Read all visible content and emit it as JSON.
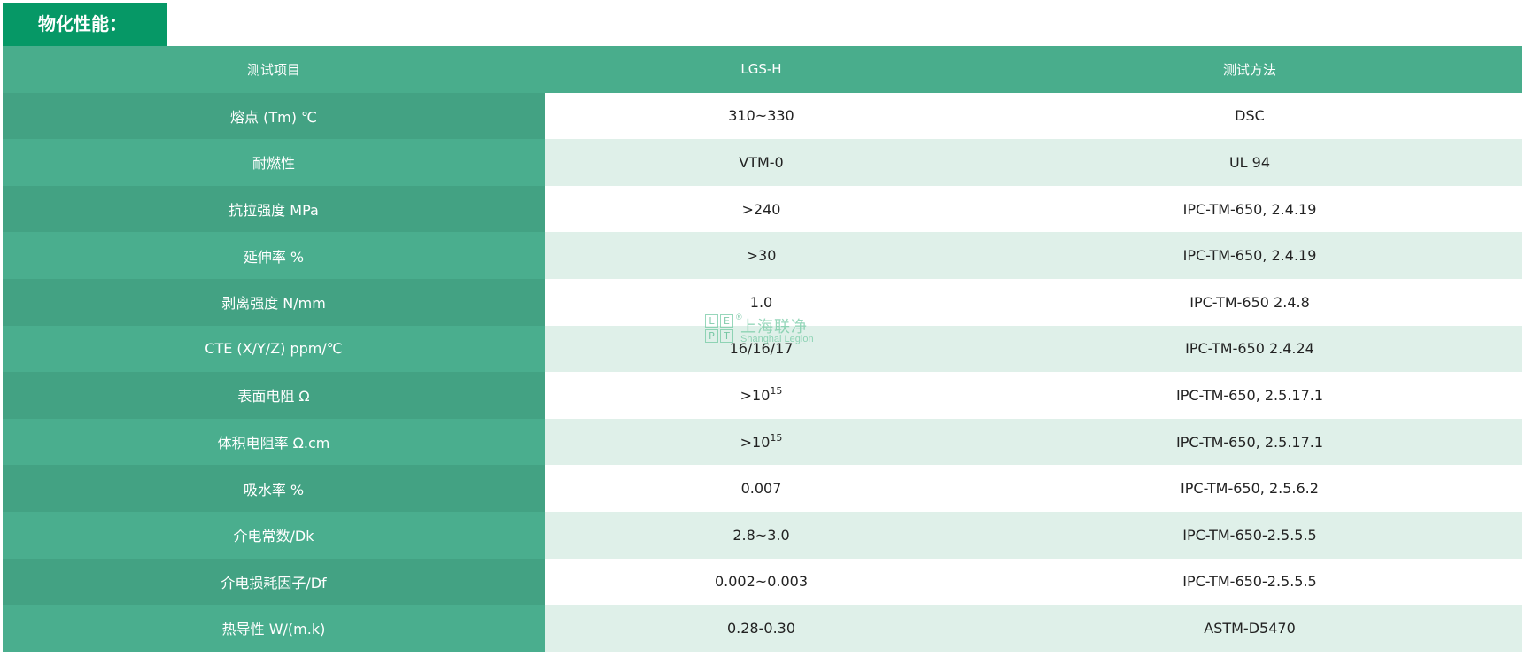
{
  "title": "物化性能：",
  "table": {
    "headers": [
      "测试项目",
      "LGS-H",
      "测试方法"
    ],
    "rows": [
      {
        "item": "熔点 (Tm) ℃",
        "value": "310~330",
        "method": "DSC"
      },
      {
        "item": "耐燃性",
        "value": "VTM-0",
        "method": "UL 94"
      },
      {
        "item": "抗拉强度 MPa",
        "value": ">240",
        "method": "IPC-TM-650, 2.4.19"
      },
      {
        "item": "延伸率 %",
        "value": ">30",
        "method": "IPC-TM-650, 2.4.19"
      },
      {
        "item": "剥离强度 N/mm",
        "value": "1.0",
        "method": "IPC-TM-650 2.4.8"
      },
      {
        "item": "CTE (X/Y/Z) ppm/℃",
        "value": "16/16/17",
        "method": "IPC-TM-650 2.4.24"
      },
      {
        "item": "表面电阻 Ω",
        "value": ">10",
        "value_sup": "15",
        "method": "IPC-TM-650, 2.5.17.1"
      },
      {
        "item": "体积电阻率  Ω.cm",
        "value": ">10",
        "value_sup": "15",
        "method": "IPC-TM-650, 2.5.17.1"
      },
      {
        "item": "吸水率  %",
        "value": "0.007",
        "method": "IPC-TM-650, 2.5.6.2"
      },
      {
        "item": "介电常数/Dk",
        "value": "2.8~3.0",
        "method": "IPC-TM-650-2.5.5.5"
      },
      {
        "item": "介电损耗因子/Df",
        "value": "0.002~0.003",
        "method": "IPC-TM-650-2.5.5.5"
      },
      {
        "item": "热导性  W/(m.k)",
        "value": "0.28-0.30",
        "method": "ASTM-D5470"
      }
    ]
  },
  "watermark": {
    "letters": [
      "L",
      "E",
      "P",
      "T"
    ],
    "registered": "®",
    "name_cn": "上海联净",
    "name_en": "Shanghai Legion"
  },
  "colors": {
    "title_bg": "#069866",
    "header_bg": "#49ad8c",
    "item_col_bg": "#43a283",
    "stripe_bg": "#dff0e9"
  }
}
